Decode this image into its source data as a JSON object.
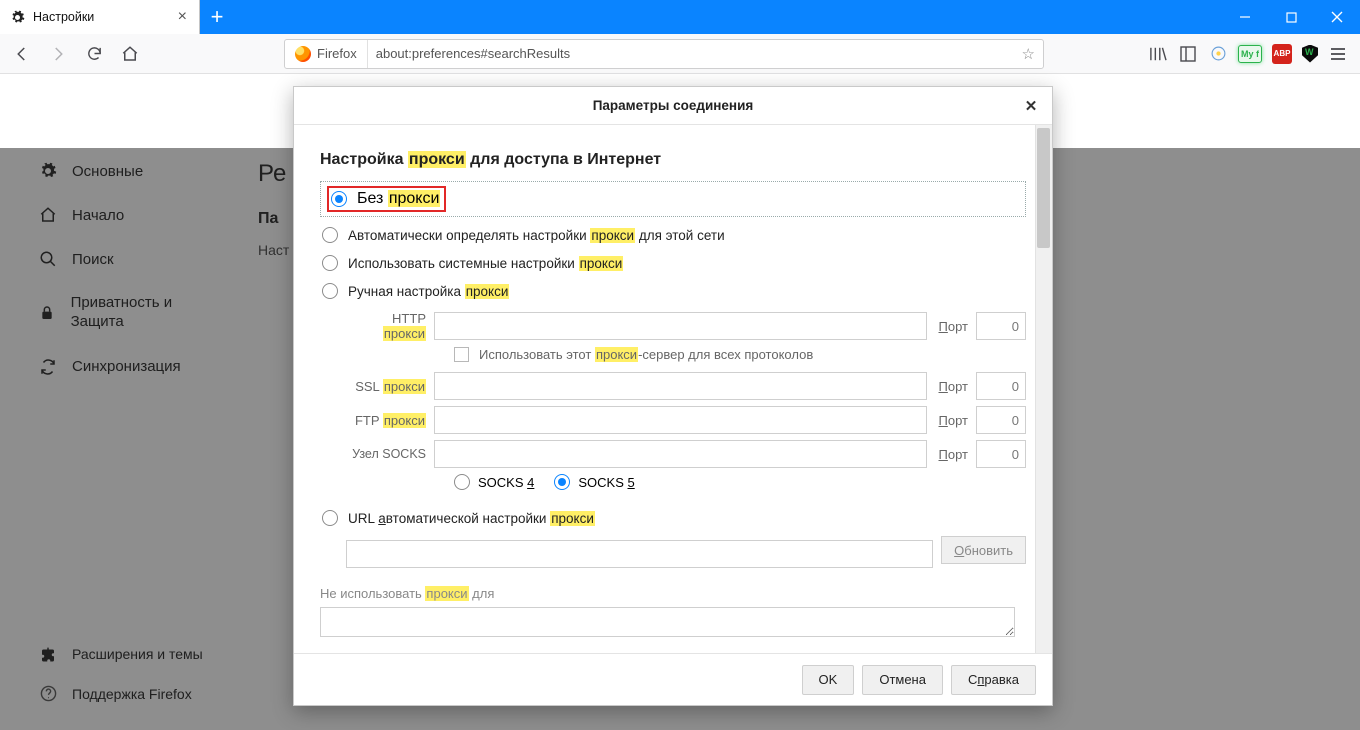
{
  "tab": {
    "title": "Настройки"
  },
  "url": {
    "brand": "Firefox",
    "address": "about:preferences#searchResults"
  },
  "sidebar": {
    "items": [
      {
        "label": "Основные"
      },
      {
        "label": "Начало"
      },
      {
        "label": "Поиск"
      },
      {
        "label": "Приватность и Защита"
      },
      {
        "label": "Синхронизация"
      }
    ],
    "bottom": [
      {
        "label": "Расширения и темы"
      },
      {
        "label": "Поддержка Firefox"
      }
    ]
  },
  "page": {
    "heading_prefix": "Ре",
    "sub1": "Па",
    "sub2": "Наст"
  },
  "dialog": {
    "title": "Параметры соединения",
    "heading_pre": "Настройка ",
    "heading_hl": "прокси",
    "heading_post": " для доступа в Интернет",
    "opt_no_pre": "Без ",
    "opt_no_hl": "прокси",
    "opt_auto_pre": "Автоматически определять настройки ",
    "opt_auto_hl": "прокси",
    "opt_auto_post": " для этой сети",
    "opt_sys_pre": "Использовать системные настройки ",
    "opt_sys_hl": "прокси",
    "opt_manual_pre": "Ручная настройка ",
    "opt_manual_hl": "прокси",
    "http_label_pre": "HTTP ",
    "http_label_hl": "прокси",
    "use_all_pre": "Использовать этот ",
    "use_all_hl": "прокси",
    "use_all_post": "-сервер для всех протоколов",
    "ssl_label_pre": "SSL ",
    "ssl_label_hl": "прокси",
    "ftp_label_pre": "FTP ",
    "ftp_label_hl": "прокси",
    "socks_label": "Узел SOCKS",
    "port_label": "Порт",
    "port_label_u": "П",
    "port_val": "0",
    "socks4_pre": "SOCKS ",
    "socks4_u": "4",
    "socks5_pre": "SOCKS ",
    "socks5_u": "5",
    "opt_pac_pre": "URL ",
    "opt_pac_u": "а",
    "opt_pac_mid": "втоматической настройки ",
    "opt_pac_hl": "прокси",
    "refresh_u": "О",
    "refresh_post": "бновить",
    "noproxy_pre": "Не использовать ",
    "noproxy_hl": "прокси",
    "noproxy_post": " для",
    "ok": "OK",
    "cancel": "Отмена",
    "help_pre": "С",
    "help_u": "п",
    "help_post": "равка"
  },
  "ext": {
    "myf": "My f",
    "abp": "ABP"
  }
}
